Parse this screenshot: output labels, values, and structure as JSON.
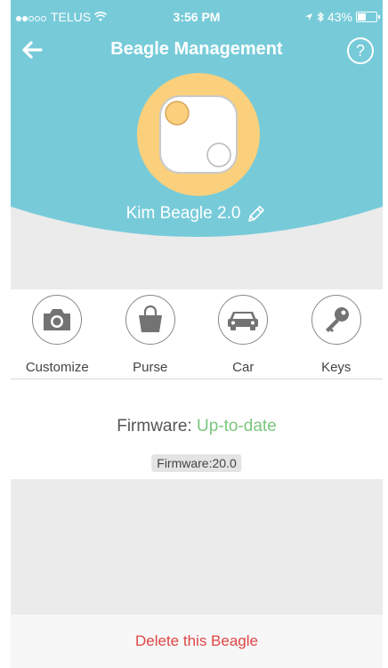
{
  "status_bar": {
    "carrier": "TELUS",
    "time": "3:56 PM",
    "battery": "43%",
    "signal_bars_filled": 2,
    "signal_bars_total": 5,
    "battery_level": 0.43
  },
  "header": {
    "title": "Beagle Management",
    "back_icon": "arrow-left-icon",
    "help_label": "?"
  },
  "device": {
    "name": "Kim Beagle 2.0",
    "edit_icon": "pencil-icon"
  },
  "categories": [
    {
      "label": "Customize",
      "icon": "camera-icon"
    },
    {
      "label": "Purse",
      "icon": "bag-icon"
    },
    {
      "label": "Car",
      "icon": "car-icon"
    },
    {
      "label": "Keys",
      "icon": "key-icon"
    }
  ],
  "firmware": {
    "label": "Firmware:",
    "status": "Up-to-date",
    "version_badge": "Firmware:20.0"
  },
  "actions": {
    "delete_label": "Delete this Beagle"
  },
  "colors": {
    "teal": "#77cbd9",
    "device_ring": "#fbd07c",
    "status_green": "#7bc67e",
    "delete_red": "#e04646"
  }
}
